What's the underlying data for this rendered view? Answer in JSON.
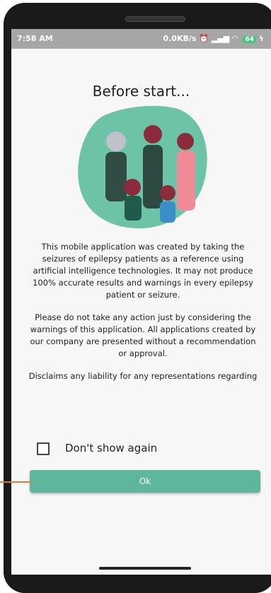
{
  "statusbar": {
    "time": "7:58 AM",
    "right_text": "0.0KB/s",
    "battery": "64",
    "icons": [
      "alarm-icon",
      "signal-icon",
      "wifi-icon",
      "battery-icon",
      "charging-icon"
    ]
  },
  "dialog": {
    "title": "Before start...",
    "paragraphs": [
      "This mobile application was created by taking the seizures of epilepsy patients as a reference using artificial intelligence technologies. It may not produce 100% accurate results and warnings in every epilepsy patient or seizure.",
      "Please do not take any action just by considering the warnings of this application. All applications created by our company are presented without a recommendation or approval.",
      "Disclaims any liability for any representations regarding its"
    ],
    "checkbox_label": "Don't show again",
    "checkbox_checked": false,
    "ok_label": "Ok"
  },
  "colors": {
    "accent": "#5fb79b",
    "statusbar": "#a6a6a6",
    "blob": "#6cc3a5",
    "marker": "#e07a2f"
  }
}
